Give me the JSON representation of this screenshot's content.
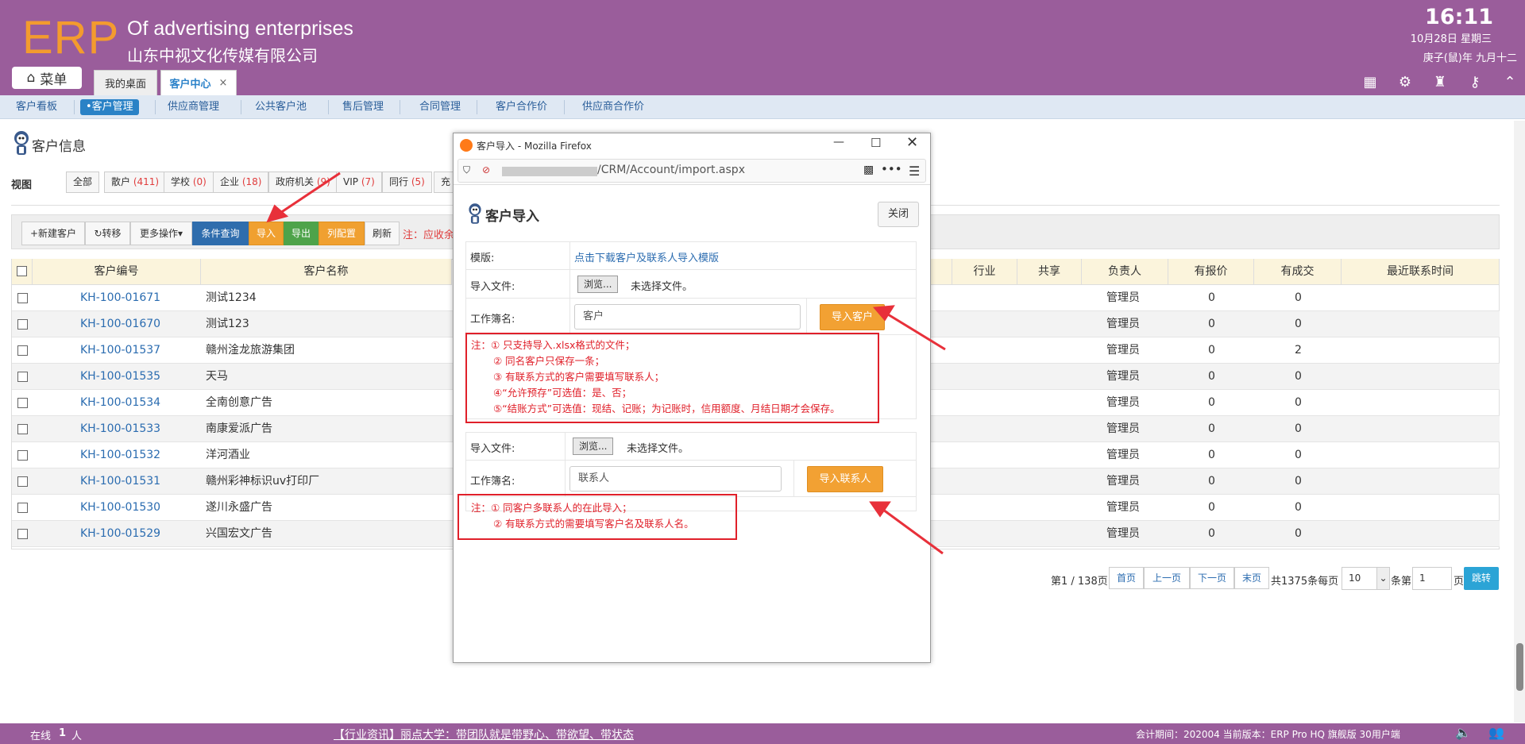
{
  "header": {
    "logo": "ERP",
    "tagline_en": "Of advertising enterprises",
    "company": "山东中视文化传媒有限公司",
    "clock": "16:11",
    "date_line1": "10月28日 星期三",
    "date_line2": "庚子(鼠)年 九月十二"
  },
  "top": {
    "menu_label": "菜单",
    "tabs": [
      {
        "label": "我的桌面"
      },
      {
        "label": "客户中心"
      }
    ]
  },
  "subnav": [
    "客户看板",
    "•客户管理",
    "供应商管理",
    "公共客户池",
    "售后管理",
    "合同管理",
    "客户合作价",
    "供应商合作价"
  ],
  "page": {
    "title": "客户信息",
    "view_label": "视图"
  },
  "views": [
    {
      "label": "全部",
      "count": ""
    },
    {
      "label": "散户",
      "count": "(411)"
    },
    {
      "label": "学校",
      "count": "(0)"
    },
    {
      "label": "企业",
      "count": "(18)"
    },
    {
      "label": "政府机关",
      "count": "(9)"
    },
    {
      "label": "VIP",
      "count": "(7)"
    },
    {
      "label": "同行",
      "count": "(5)"
    },
    {
      "label": "充",
      "count": ""
    }
  ],
  "toolbar": {
    "new": "+新建客户",
    "transfer": "转移",
    "more": "更多操作▾",
    "query": "条件查询",
    "import": "导入",
    "export": "导出",
    "columns": "列配置",
    "refresh": "刷新",
    "note": "注：应收余"
  },
  "grid": {
    "headers": [
      "客户编号",
      "客户名称",
      "行业",
      "共享",
      "负责人",
      "有报价",
      "有成交",
      "最近联系时间"
    ],
    "rows": [
      {
        "code": "KH-100-01671",
        "name": "测试1234",
        "owner": "管理员",
        "quoted": "0",
        "deal": "0"
      },
      {
        "code": "KH-100-01670",
        "name": "测试123",
        "owner": "管理员",
        "quoted": "0",
        "deal": "0"
      },
      {
        "code": "KH-100-01537",
        "name": "赣州淦龙旅游集团",
        "owner": "管理员",
        "quoted": "0",
        "deal": "2"
      },
      {
        "code": "KH-100-01535",
        "name": "天马",
        "owner": "管理员",
        "quoted": "0",
        "deal": "0"
      },
      {
        "code": "KH-100-01534",
        "name": "全南创意广告",
        "owner": "管理员",
        "quoted": "0",
        "deal": "0"
      },
      {
        "code": "KH-100-01533",
        "name": "南康爱派广告",
        "owner": "管理员",
        "quoted": "0",
        "deal": "0"
      },
      {
        "code": "KH-100-01532",
        "name": "洋河酒业",
        "owner": "管理员",
        "quoted": "0",
        "deal": "0"
      },
      {
        "code": "KH-100-01531",
        "name": "赣州彩神标识uv打印厂",
        "owner": "管理员",
        "quoted": "0",
        "deal": "0"
      },
      {
        "code": "KH-100-01530",
        "name": "遂川永盛广告",
        "owner": "管理员",
        "quoted": "0",
        "deal": "0"
      },
      {
        "code": "KH-100-01529",
        "name": "兴国宏文广告",
        "owner": "管理员",
        "quoted": "0",
        "deal": "0"
      }
    ]
  },
  "pager": {
    "page_text": "第1 / 138页",
    "first": "首页",
    "prev": "上一页",
    "next": "下一页",
    "last": "末页",
    "total": "共1375条每页",
    "size": "10",
    "goto_label": "条第",
    "goto_value": "1",
    "page_suffix": "页",
    "jump": "跳转"
  },
  "footer": {
    "online_label": "在线",
    "online_count": "1",
    "online_unit": "人",
    "news": "【行业资讯】丽点大学：带团队就是带野心、带欲望、带状态",
    "version": "会计期间：202004 当前版本：ERP Pro HQ 旗舰版 30用户端"
  },
  "popup": {
    "window_title": "客户导入 - Mozilla Firefox",
    "url": "/CRM/Account/import.aspx",
    "title": "客户导入",
    "close": "关闭",
    "template_label": "模版:",
    "template_link": "点击下载客户及联系人导入模版",
    "file_label": "导入文件:",
    "browse": "浏览...",
    "no_file": "未选择文件。",
    "sheet_label": "工作簿名:",
    "sheet_customer": "客户",
    "import_customer": "导入客户",
    "notes_customer": [
      "注：① 只支持导入.xlsx格式的文件；",
      "② 同名客户只保存一条；",
      "③ 有联系方式的客户需要填写联系人；",
      "④“允许预存”可选值：是、否；",
      "⑤“结账方式”可选值：现结、记账；为记账时，信用额度、月结日期才会保存。"
    ],
    "sheet_contact": "联系人",
    "import_contact": "导入联系人",
    "notes_contact": [
      "注：① 同客户多联系人的在此导入；",
      "② 有联系方式的需要填写客户名及联系人名。"
    ]
  }
}
